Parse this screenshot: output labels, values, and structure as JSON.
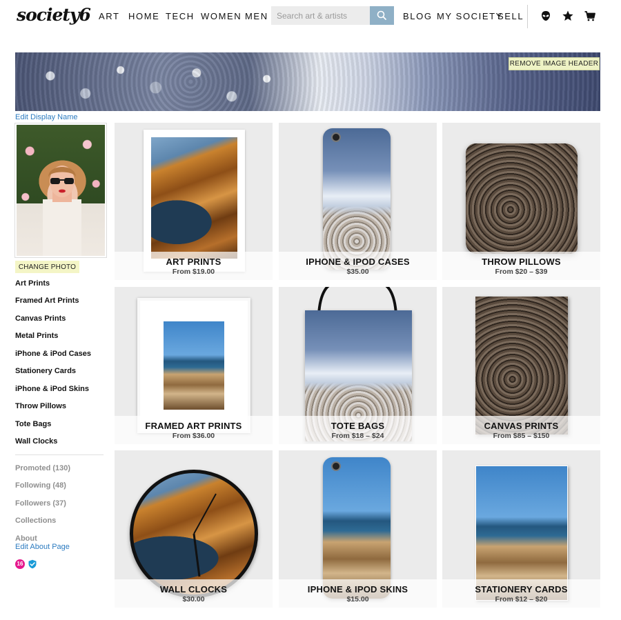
{
  "nav": {
    "logo": "society6",
    "links": [
      "ART",
      "HOME",
      "TECH",
      "WOMEN",
      "MEN"
    ],
    "search_placeholder": "Search art & artists",
    "right_links": [
      "BLOG",
      "MY SOCIETY",
      "SELL"
    ],
    "icons": [
      "alien-icon",
      "star-icon",
      "cart-icon"
    ]
  },
  "header": {
    "remove_label": "REMOVE IMAGE HEADER"
  },
  "profile": {
    "edit_display_name": "Edit Display Name",
    "change_photo": "CHANGE PHOTO",
    "categories": [
      "Art Prints",
      "Framed Art Prints",
      "Canvas Prints",
      "Metal Prints",
      "iPhone & iPod Cases",
      "Stationery Cards",
      "iPhone & iPod Skins",
      "Throw Pillows",
      "Tote Bags",
      "Wall Clocks"
    ],
    "stats": [
      "Promoted (130)",
      "Following (48)",
      "Followers (37)",
      "Collections"
    ],
    "about_label": "About",
    "edit_about": "Edit About Page",
    "badge_count": "16"
  },
  "products": [
    {
      "title": "ART PRINTS",
      "price": "From $19.00"
    },
    {
      "title": "IPHONE & IPOD CASES",
      "price": "$35.00"
    },
    {
      "title": "THROW PILLOWS",
      "price": "From $20 – $39"
    },
    {
      "title": "FRAMED ART PRINTS",
      "price": "From $36.00"
    },
    {
      "title": "TOTE BAGS",
      "price": "From $18 – $24"
    },
    {
      "title": "CANVAS PRINTS",
      "price": "From $85 – $150"
    },
    {
      "title": "WALL CLOCKS",
      "price": "$30.00"
    },
    {
      "title": "IPHONE & IPOD SKINS",
      "price": "$15.00"
    },
    {
      "title": "STATIONERY CARDS",
      "price": "From $12 – $20"
    }
  ],
  "colors": {
    "link_blue": "#2c7bc0",
    "search_button": "#8fb0c6",
    "highlight_yellow": "#f4f5c6",
    "badge_pink": "#e6198e",
    "verified_blue": "#1a9bd7"
  }
}
